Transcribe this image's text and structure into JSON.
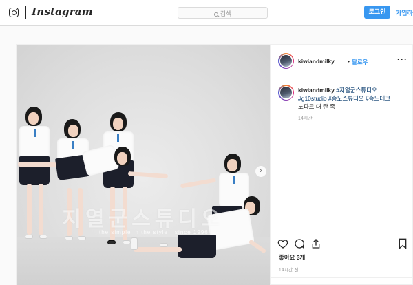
{
  "header": {
    "logo_text": "Instagram",
    "search_placeholder": "검색",
    "login_label": "로그인",
    "signup_label": "가입하"
  },
  "post": {
    "username": "kiwiandmilky",
    "follow_separator": "•",
    "follow_label": "팔로우",
    "more_label": "···",
    "caption_user": "kiwiandmilky",
    "caption_tags": [
      "#지열군스튜디오",
      "#g10studio",
      "#송도스튜디오",
      "#송도테크"
    ],
    "caption_tail": "노파크 대 란 족",
    "caption_time": "14시간",
    "likes": "좋아요 3개",
    "post_time": "14시간 전",
    "photo_watermark": "지열군스튜디오",
    "photo_watermark_sub": "the simple in the style · since 1996",
    "next_arrow": "›",
    "comment_placeholder": ""
  },
  "icons": {
    "logo": "instagram-camera-icon",
    "search": "search-icon",
    "more": "more-options-icon",
    "like": "heart-icon",
    "comment": "comment-icon",
    "share": "share-icon",
    "save": "bookmark-icon",
    "next": "chevron-right-icon"
  },
  "colors": {
    "accent": "#3897f0",
    "hashtag": "#003569",
    "border": "#dbdbdb",
    "background": "#fafafa"
  }
}
